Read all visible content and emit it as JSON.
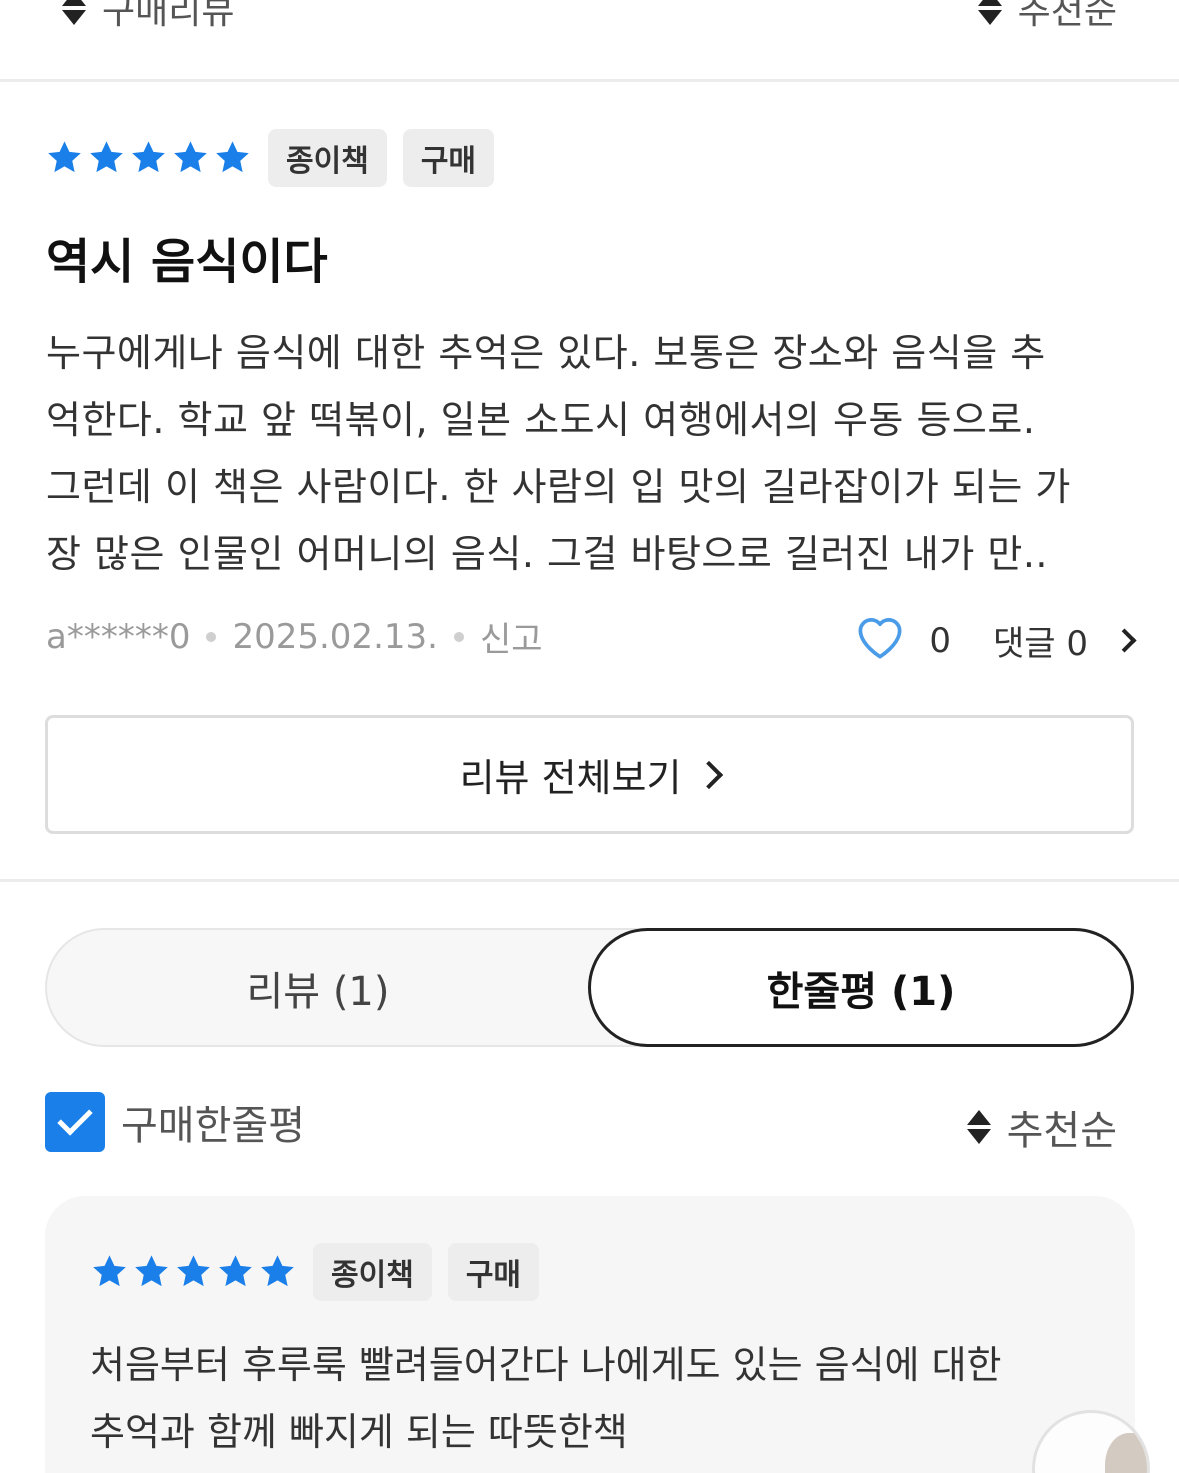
{
  "top_filter": {
    "label": "구매리뷰",
    "sort_label": "추천순"
  },
  "review": {
    "rating": 5,
    "chips": [
      "종이책",
      "구매"
    ],
    "title": "역시 음식이다",
    "body_lines": [
      "누구에게나 음식에 대한 추억은 있다. 보통은 장소와 음식을 추",
      "억한다. 학교 앞 떡볶이, 일본 소도시 여행에서의 우동 등으로.",
      "그런데 이 책은 사람이다. 한 사람의 입 맛의 길라잡이가 되는 가",
      "장 많은 인물인 어머니의 음식. 그걸 바탕으로 길러진 내가 만.."
    ],
    "author": "a******0",
    "date": "2025.02.13.",
    "report_label": "신고",
    "likes": "0",
    "comments_label": "댓글 0"
  },
  "all_reviews_label": "리뷰 전체보기",
  "tabs": [
    {
      "label": "리뷰 (1)",
      "active": false
    },
    {
      "label": "한줄평 (1)",
      "active": true
    }
  ],
  "filter": {
    "checkbox_label": "구매한줄평",
    "checked": true,
    "sort_label": "추천순"
  },
  "one_liner": {
    "rating": 5,
    "chips": [
      "종이책",
      "구매"
    ],
    "body_lines": [
      "처음부터 후루룩 빨려들어간다 나에게도 있는 음식에 대한",
      "추억과 함께 빠지게 되는 따뜻한책"
    ]
  },
  "colors": {
    "accent": "#1a7fe8",
    "heart": "#4a9be8"
  }
}
